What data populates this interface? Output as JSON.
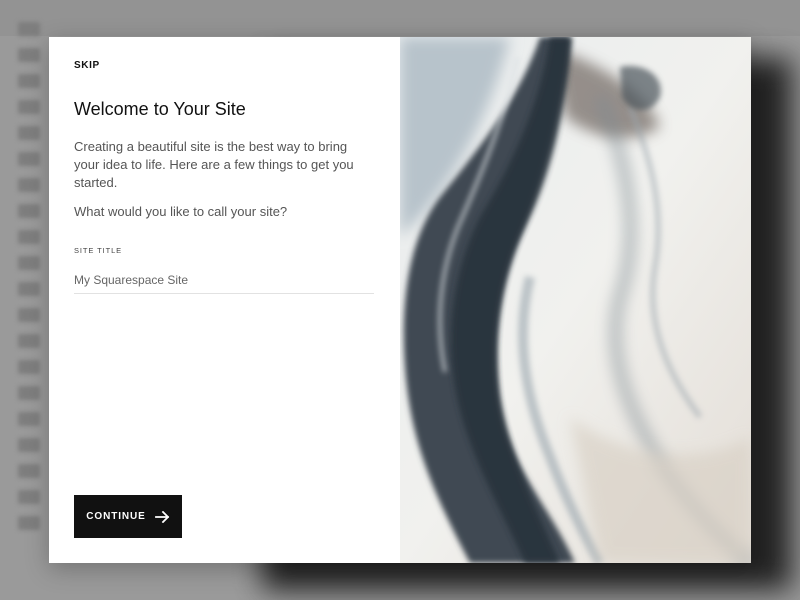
{
  "modal": {
    "skip_label": "SKIP",
    "title": "Welcome to Your Site",
    "intro": "Creating a beautiful site is the best way to bring your idea to life. Here are a few things to get you started.",
    "question": "What would you like to call your site?",
    "field_label": "SITE TITLE",
    "field_value": "My Squarespace Site",
    "continue_label": "CONTINUE",
    "continue_icon": "arrow-right-icon"
  },
  "colors": {
    "overlay": "#8c8c8c",
    "button_bg": "#111111",
    "button_text": "#ffffff",
    "text_primary": "#111111",
    "text_secondary": "#555555"
  }
}
